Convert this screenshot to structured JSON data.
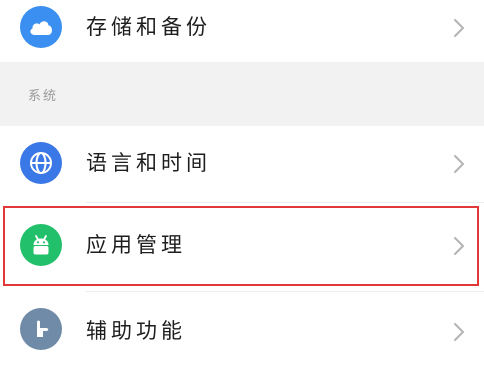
{
  "rows": {
    "storage": {
      "label": "存储和备份",
      "icon": "cloud-icon"
    },
    "language": {
      "label": "语言和时间",
      "icon": "globe-icon"
    },
    "apps": {
      "label": "应用管理",
      "icon": "android-icon"
    },
    "accessibility": {
      "label": "辅助功能",
      "icon": "hand-icon"
    }
  },
  "section": {
    "title": "系统"
  },
  "colors": {
    "storage_icon_bg": "#3a8ff0",
    "language_icon_bg": "#3b78e7",
    "apps_icon_bg": "#22c06b",
    "accessibility_icon_bg": "#6f8ba7",
    "highlight_border": "#e23838",
    "section_bg": "#f2f2f2"
  }
}
